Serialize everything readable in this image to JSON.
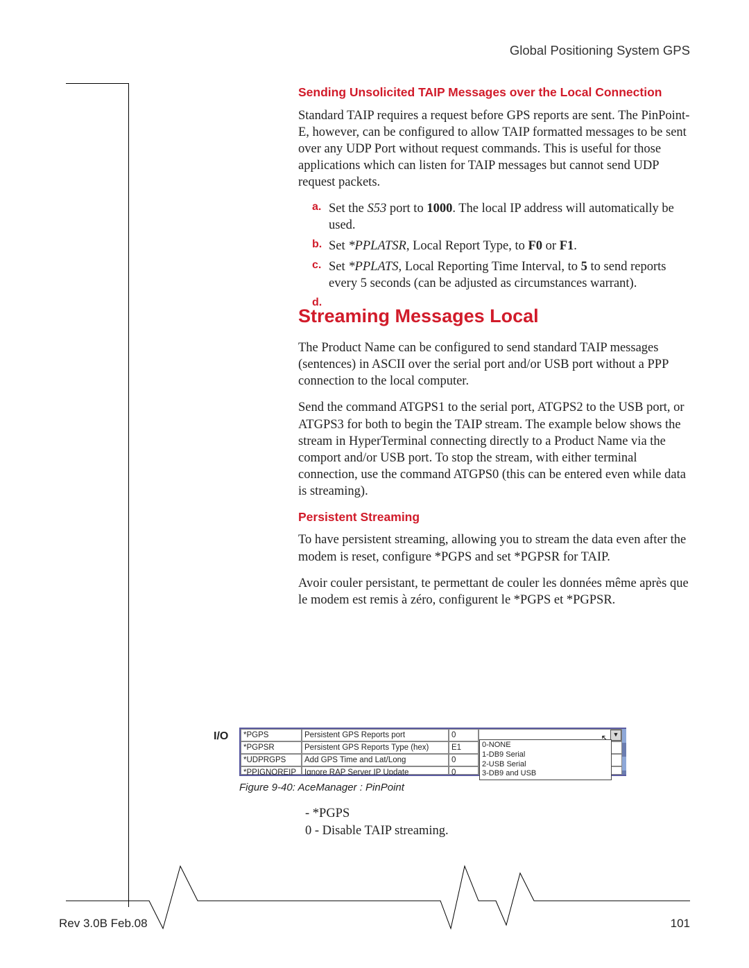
{
  "header": "Global Positioning System GPS",
  "section1": {
    "title": "Sending Unsolicited TAIP Messages over the Local Connection",
    "intro": "Standard TAIP requires a request before GPS reports are sent. The PinPoint-E, however, can be configured to allow TAIP formatted messages to be sent over any UDP Port without request commands. This is useful for those applications which can listen for TAIP messages but cannot send UDP request packets.",
    "items": {
      "a": {
        "marker": "a.",
        "prefix": "Set the ",
        "ital1": "S53",
        "mid": " port to ",
        "bold": "1000",
        "suffix": ". The local IP address will automatically be used."
      },
      "b": {
        "marker": "b.",
        "prefix": "Set ",
        "ital1": "*PPLATSR",
        "mid": ", Local Report Type, to ",
        "b1": "F0",
        "or": " or ",
        "b2": "F1",
        "suffix": "."
      },
      "c": {
        "marker": "c.",
        "prefix": "Set ",
        "ital1": "*PPLATS,",
        "mid": " Local Reporting Time Interval, to ",
        "b1": "5",
        "suffix": " to send reports every 5 seconds (can be adjusted as circumstances warrant)."
      },
      "d": {
        "marker": "d."
      }
    }
  },
  "section2": {
    "title": "Streaming Messages Local",
    "p1": "The Product Name can be configured to send standard TAIP messages (sentences) in ASCII over the serial port and/or USB port without a PPP connection to the local computer.",
    "p2": "Send the command ATGPS1 to the serial port, ATGPS2 to the USB port, or ATGPS3 for both to begin the TAIP stream. The example below shows the stream in HyperTerminal connecting directly to a Product Name via the comport and/or USB port. To stop the stream, with either terminal connection, use the command ATGPS0 (this can be entered even while data is streaming).",
    "sub": "Persistent Streaming",
    "p3": "To have persistent streaming, allowing you to stream the data even after the modem is reset, configure *PGPS and set *PGPSR for TAIP.",
    "p4": "Avoir couler persistant, te permettant de couler les données même après que le modem est remis à zéro, configurent le *PGPS et *PGPSR."
  },
  "ioLabel": "I/O",
  "table": {
    "rows": [
      {
        "c1": "*PGPS",
        "c2": "Persistent GPS Reports port",
        "c3": "0"
      },
      {
        "c1": "*PGPSR",
        "c2": "Persistent GPS Reports Type (hex)",
        "c3": "E1"
      },
      {
        "c1": "*UDPRGPS",
        "c2": "Add GPS Time and Lat/Long",
        "c3": "0"
      },
      {
        "c1": "*PPIGNOREIP",
        "c2": "Ignore RAP Server IP Update",
        "c3": "0"
      }
    ],
    "dropdown": [
      "0-NONE",
      "1-DB9 Serial",
      "2-USB Serial",
      "3-DB9 and USB"
    ]
  },
  "caption": "Figure 9-40:  AceManager : PinPoint",
  "below": {
    "l1": " - *PGPS",
    "l2": "0 - Disable TAIP streaming."
  },
  "footer": {
    "left": "Rev 3.0B  Feb.08",
    "right": "101"
  }
}
